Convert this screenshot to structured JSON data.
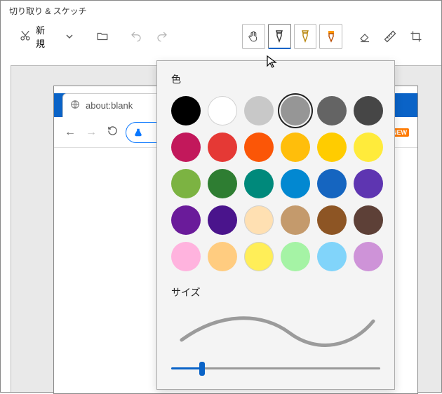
{
  "window": {
    "title": "切り取り & スケッチ"
  },
  "toolbar": {
    "new_label": "新規"
  },
  "browser": {
    "tab_label": "about:blank"
  },
  "badges": {
    "new": "NEW"
  },
  "picker": {
    "color_label": "色",
    "size_label": "サイズ",
    "selected_index": 3,
    "slider_value": 15,
    "colors": [
      "#000000",
      "#ffffff",
      "#c8c8c8",
      "#969696",
      "#646464",
      "#464646",
      "#c2185b",
      "#e53935",
      "#fb5607",
      "#ffbe0b",
      "#ffcc00",
      "#ffeb3b",
      "#7cb342",
      "#2e7d32",
      "#00897b",
      "#0288d1",
      "#1565c0",
      "#5e35b1",
      "#6a1b9a",
      "#4a148c",
      "#ffe0b2",
      "#c49a6c",
      "#8d5524",
      "#5d4037",
      "#ffb3de",
      "#ffcc80",
      "#ffee58",
      "#a5f3a5",
      "#81d4fa",
      "#ce93d8"
    ]
  }
}
